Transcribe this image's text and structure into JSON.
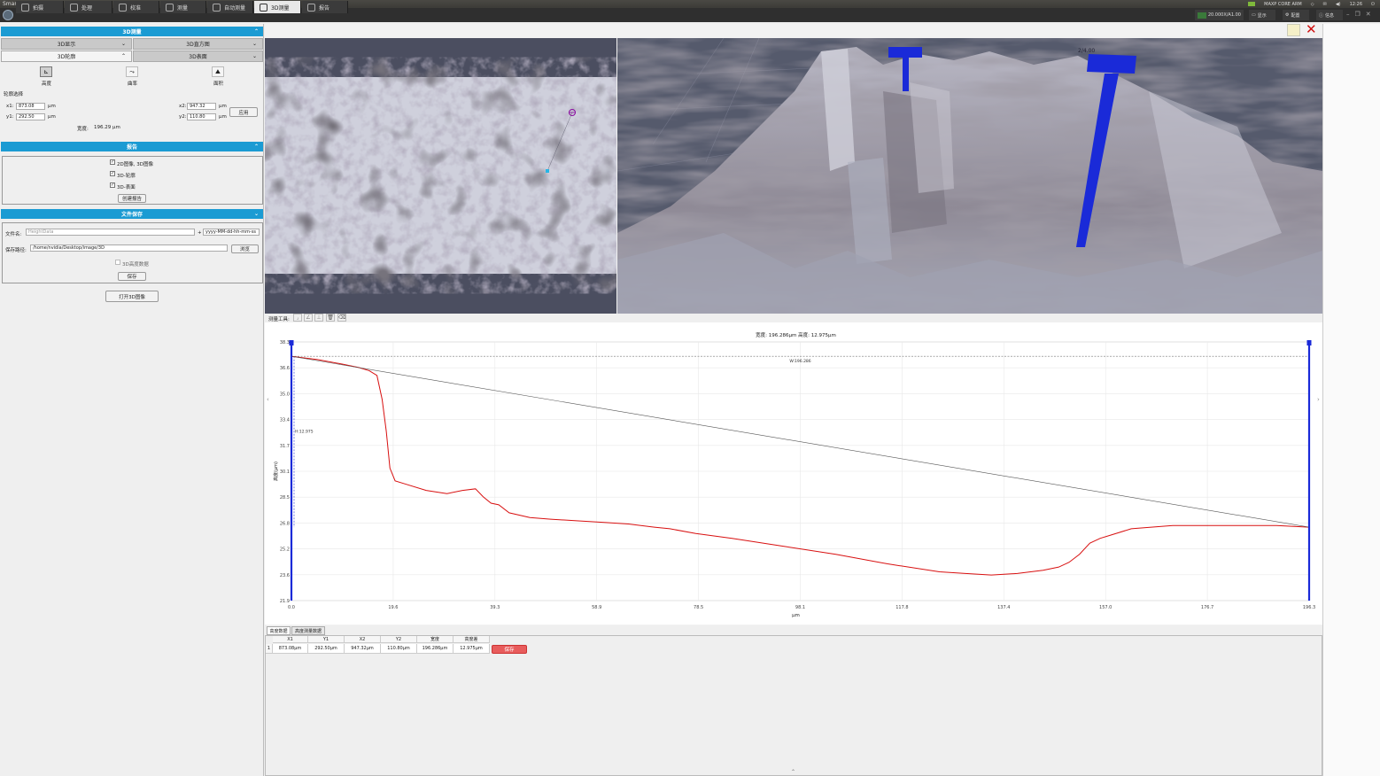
{
  "titlebar": {
    "title": "Smart SoftWare"
  },
  "tray": {
    "cpu_label": "MAXP CORE ARM",
    "time": "12:26"
  },
  "tabs": [
    {
      "label": "拍摄",
      "icon": "camera-icon"
    },
    {
      "label": "处理",
      "icon": "process-icon"
    },
    {
      "label": "校准",
      "icon": "ruler-icon"
    },
    {
      "label": "测量",
      "icon": "measure-icon"
    },
    {
      "label": "自动测量",
      "icon": "auto-measure-icon"
    },
    {
      "label": "3D测量",
      "icon": "3d-icon"
    },
    {
      "label": "报告",
      "icon": "report-icon"
    }
  ],
  "active_tab": "3D测量",
  "right_tools": {
    "objective": "20.000X/A1.00",
    "display": "显示",
    "config": "配置",
    "info": "信息"
  },
  "left": {
    "section_3d": "3D测量",
    "subtabs": [
      "3D显示",
      "3D直方图",
      "3D轮廓",
      "3D表面"
    ],
    "tools": [
      "高度",
      "曲率",
      "面积"
    ],
    "contour_select": "轮廓选择",
    "x1_label": "x1:",
    "x1": "873.08",
    "y1_label": "y1:",
    "y1": "292.50",
    "x2_label": "x2:",
    "x2": "947.32",
    "y2_label": "y2:",
    "y2": "110.80",
    "unit": "μm",
    "apply": "应用",
    "width_label": "宽度:",
    "width_value": "196.29 μm",
    "section_report": "报告",
    "report_opts": [
      "2D图像, 3D图像",
      "3D-轮廓",
      "3D-表面"
    ],
    "create_report": "创建报告",
    "section_save": "文件保存",
    "filename_label": "文件名:",
    "filename_placeholder": "HeightData",
    "plus": "+",
    "date_format": "yyyy-MM-dd-hh-mm-ss",
    "path_label": "保存路径:",
    "path": "/home/nvidia/Desktop/image/3D",
    "browse": "浏览",
    "height_data_cb": "3D高度数据",
    "save": "保存",
    "open_3d": "打开3D图像"
  },
  "measure_toolbar_label": "测量工具:",
  "view3d_label": "2/4.00",
  "chart_data": {
    "type": "line",
    "title": "宽度: 196.286μm  高度: 12.975μm",
    "xlabel": "μm",
    "ylabel": "高度(μm)",
    "xlim": [
      0,
      196.3
    ],
    "ylim": [
      21.9,
      38.1
    ],
    "x_ticks": [
      "0.0",
      "19.6",
      "39.3",
      "58.9",
      "78.5",
      "98.1",
      "117.8",
      "137.4",
      "157.0",
      "176.7",
      "196.3"
    ],
    "y_ticks": [
      "21.9",
      "23.6",
      "25.2",
      "26.8",
      "28.5",
      "30.1",
      "31.7",
      "33.4",
      "35.0",
      "36.6",
      "38.3"
    ],
    "width_annotation": "W:196.286",
    "height_annotation": "H:12.975",
    "series": [
      {
        "color": "#d81010",
        "x": [
          0,
          5,
          10,
          13,
          15,
          16.5,
          17.5,
          18.3,
          19,
          20,
          22,
          26,
          30,
          33,
          35.5,
          37,
          38.5,
          40,
          42,
          46,
          50,
          55,
          60,
          65,
          70,
          73,
          78,
          85,
          95,
          105,
          115,
          125,
          130,
          135,
          140,
          145,
          148,
          150,
          152,
          154,
          156,
          158,
          162,
          170,
          180,
          190,
          196.3
        ],
        "y": [
          37.2,
          37.0,
          36.7,
          36.5,
          36.3,
          36.0,
          34.5,
          32.5,
          30.2,
          29.4,
          29.2,
          28.8,
          28.6,
          28.8,
          28.9,
          28.4,
          28.0,
          27.9,
          27.4,
          27.1,
          27.0,
          26.9,
          26.8,
          26.7,
          26.5,
          26.4,
          26.1,
          25.8,
          25.3,
          24.8,
          24.2,
          23.7,
          23.6,
          23.5,
          23.6,
          23.8,
          24.0,
          24.3,
          24.8,
          25.5,
          25.8,
          26.0,
          26.4,
          26.6,
          26.6,
          26.6,
          26.5
        ]
      },
      {
        "color": "#555555",
        "x": [
          0,
          196.3
        ],
        "y": [
          37.2,
          26.5
        ]
      }
    ],
    "grid": true
  },
  "table": {
    "tabs": [
      "高度数据",
      "高度测量数据"
    ],
    "headers": [
      "X1",
      "Y1",
      "X2",
      "Y2",
      "宽度",
      "高度差"
    ],
    "rows": [
      {
        "index": "1",
        "cells": [
          "873.08μm",
          "292.50μm",
          "947.32μm",
          "110.80μm",
          "196.286μm",
          "12.975μm"
        ],
        "action": "保存"
      }
    ]
  },
  "colors": {
    "accent": "#1b9bd3",
    "profile": "#d81010",
    "marker": "#1a2ad8",
    "save_red": "#e85c5c"
  }
}
